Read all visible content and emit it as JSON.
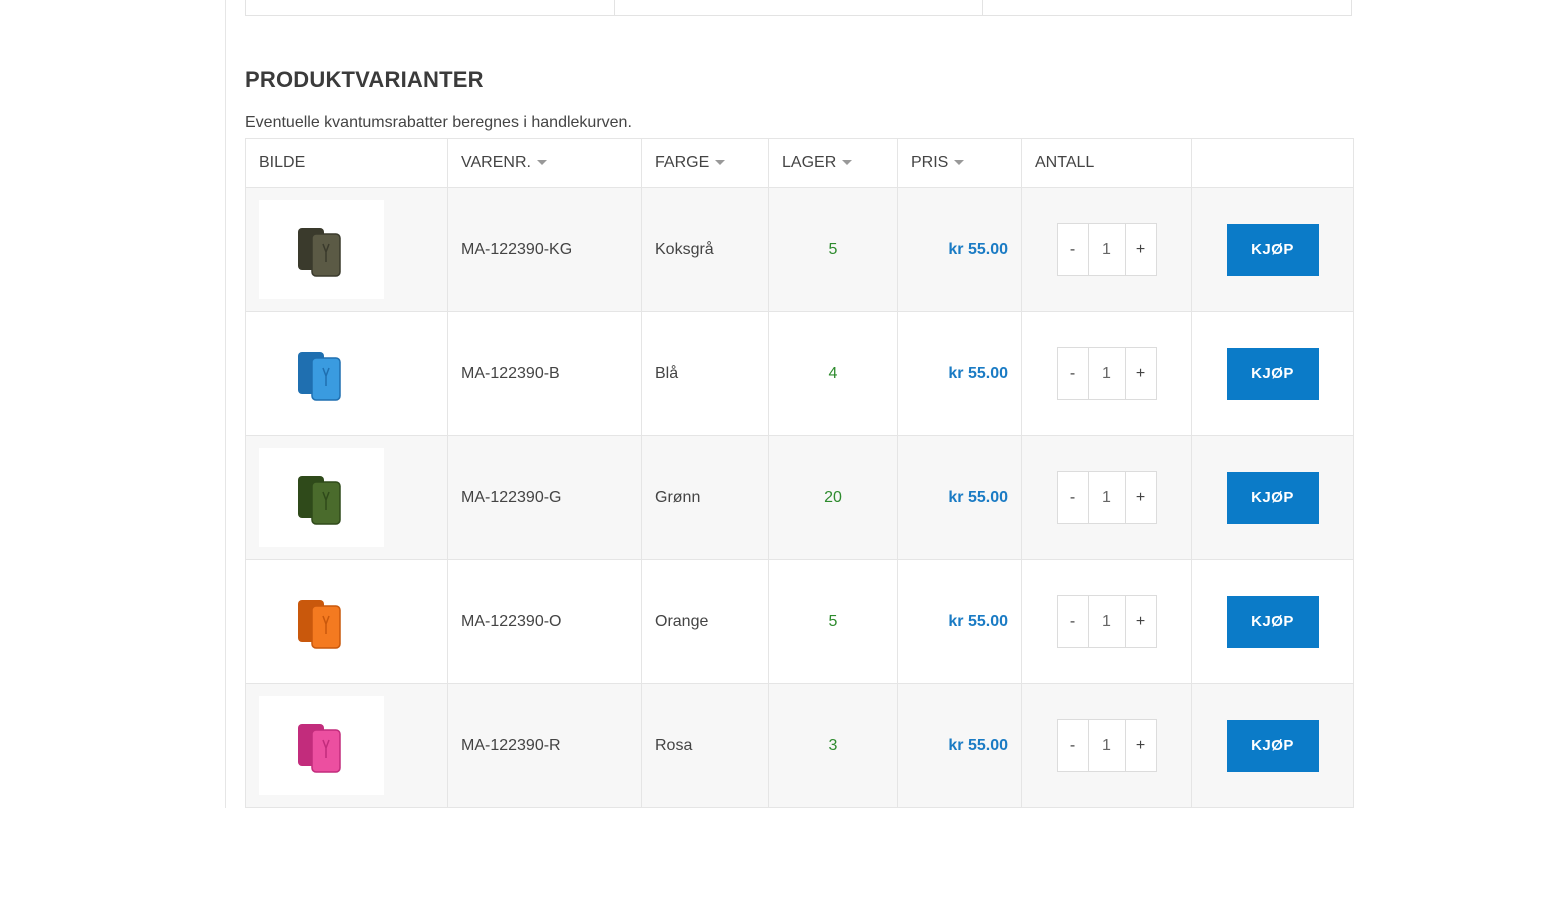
{
  "section": {
    "title": "PRODUKTVARIANTER",
    "note": "Eventuelle kvantumsrabatter beregnes i handlekurven."
  },
  "table": {
    "headers": {
      "image": "BILDE",
      "sku": "VARENR.",
      "color": "FARGE",
      "stock": "LAGER",
      "price": "PRIS",
      "quantity": "ANTALL"
    },
    "rows": [
      {
        "sku": "MA-122390-KG",
        "color": "Koksgrå",
        "stock": "5",
        "price": "kr 55.00",
        "qty": "1",
        "swatch": "#5b5a45",
        "swatch_dark": "#3a3a2c",
        "buy_label": "KJØP"
      },
      {
        "sku": "MA-122390-B",
        "color": "Blå",
        "stock": "4",
        "price": "kr 55.00",
        "qty": "1",
        "swatch": "#3a9be0",
        "swatch_dark": "#1f6fb0",
        "buy_label": "KJØP"
      },
      {
        "sku": "MA-122390-G",
        "color": "Grønn",
        "stock": "20",
        "price": "kr 55.00",
        "qty": "1",
        "swatch": "#4a6b2c",
        "swatch_dark": "#2f4a1a",
        "buy_label": "KJØP"
      },
      {
        "sku": "MA-122390-O",
        "color": "Orange",
        "stock": "5",
        "price": "kr 55.00",
        "qty": "1",
        "swatch": "#f47a20",
        "swatch_dark": "#c9580c",
        "buy_label": "KJØP"
      },
      {
        "sku": "MA-122390-R",
        "color": "Rosa",
        "stock": "3",
        "price": "kr 55.00",
        "qty": "1",
        "swatch": "#ec4fa0",
        "swatch_dark": "#c22c7c",
        "buy_label": "KJØP"
      }
    ]
  },
  "controls": {
    "minus": "-",
    "plus": "+"
  },
  "colors": {
    "accent": "#0b7bc8",
    "price": "#1a7bc4",
    "stock": "#2e8b2e"
  }
}
